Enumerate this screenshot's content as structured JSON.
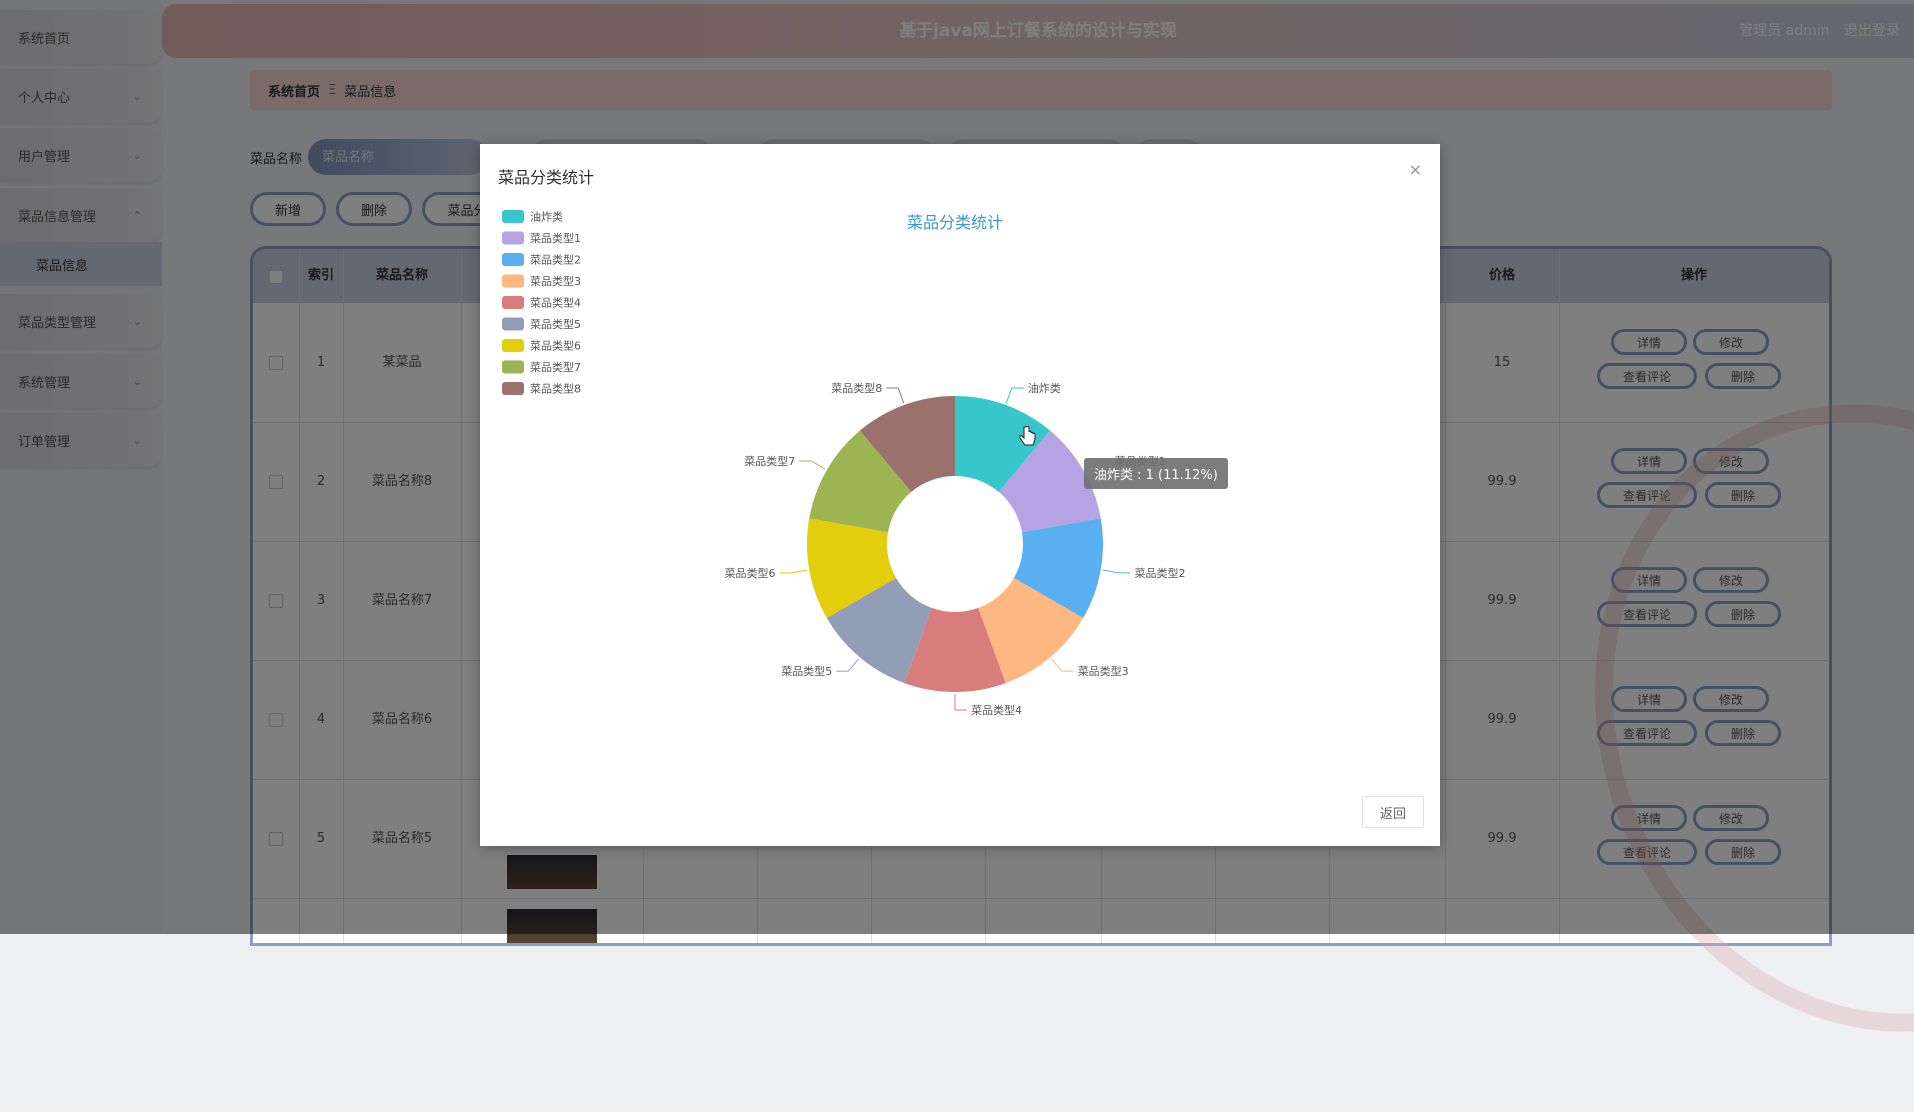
{
  "header": {
    "title": "基于java网上订餐系统的设计与实现",
    "user_label": "管理员 admin",
    "logout_label": "退出登录"
  },
  "sidebar": {
    "items": [
      {
        "label": "系统首页",
        "chevron": ""
      },
      {
        "label": "个人中心",
        "chevron": "⌄"
      },
      {
        "label": "用户管理",
        "chevron": "⌄"
      },
      {
        "label": "菜品信息管理",
        "chevron": "⌃"
      },
      {
        "label": "菜品类型管理",
        "chevron": "⌄"
      },
      {
        "label": "系统管理",
        "chevron": "⌄"
      },
      {
        "label": "订单管理",
        "chevron": "⌄"
      }
    ],
    "subitem": "菜品信息"
  },
  "breadcrumb": {
    "home": "系统首页",
    "separator": "Ξ",
    "current": "菜品信息"
  },
  "search": {
    "label": "菜品名称",
    "placeholder": "菜品名称"
  },
  "toolbar": {
    "add_label": "新增",
    "delete_label": "删除",
    "stats_label": "菜品分"
  },
  "table": {
    "headers": {
      "index": "索引",
      "name": "菜品名称",
      "price": "价格",
      "ops": "操作"
    },
    "rows": [
      {
        "index": "1",
        "name": "某菜品",
        "price": "15"
      },
      {
        "index": "2",
        "name": "菜品名称8",
        "price": "99.9"
      },
      {
        "index": "3",
        "name": "菜品名称7",
        "price": "99.9"
      },
      {
        "index": "4",
        "name": "菜品名称6",
        "price": "99.9"
      },
      {
        "index": "5",
        "name": "菜品名称5",
        "price": "99.9"
      }
    ],
    "ops": {
      "detail": "详情",
      "edit": "修改",
      "comments": "查看评论",
      "delete": "删除"
    }
  },
  "dialog": {
    "title": "菜品分类统计",
    "close": "×",
    "return_label": "返回"
  },
  "colors": {
    "accent": "#8aa0c4",
    "pie": [
      "#37c6cb",
      "#b6a3e3",
      "#5aaff0",
      "#ffb782",
      "#d87c7c",
      "#919eb5",
      "#e2ce0c",
      "#9cb552",
      "#9a716c"
    ]
  },
  "tooltip": {
    "text": "油炸类 : 1 (11.12%)"
  },
  "chart_data": {
    "type": "pie",
    "title": "菜品分类统计",
    "legend_position": "top-left",
    "categories": [
      "油炸类",
      "菜品类型1",
      "菜品类型2",
      "菜品类型3",
      "菜品类型4",
      "菜品类型5",
      "菜品类型6",
      "菜品类型7",
      "菜品类型8"
    ],
    "values": [
      1,
      1,
      1,
      1,
      1,
      1,
      1,
      1,
      1
    ]
  }
}
